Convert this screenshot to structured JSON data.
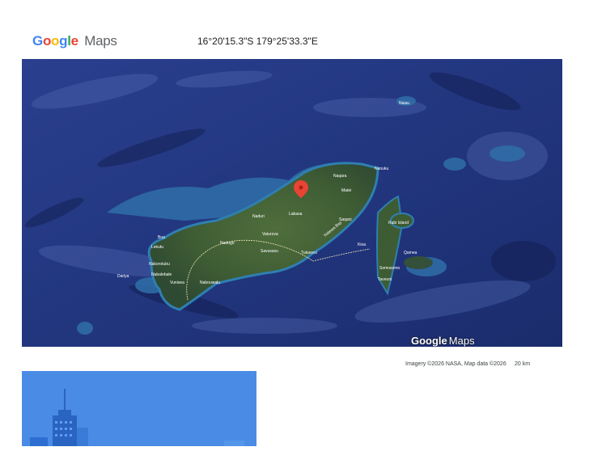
{
  "header": {
    "logo_google": "Google",
    "logo_maps": "Maps",
    "coordinates": "16°20'15.3\"S 179°25'33.3\"E"
  },
  "map": {
    "watermark_google": "Google",
    "watermark_maps": "Maps",
    "attribution": "Imagery ©2026 NASA, Map data ©2026",
    "scale": "20 km",
    "pin_color": "#ea4335",
    "labels": {
      "naiau": "Naiau",
      "nanuku": "Nanuku",
      "labasa": "Labasa",
      "naduri": "Naduri",
      "vaturova": "Vaturova",
      "savusavu": "Savusavu",
      "nabouwalu": "Nabouwalu",
      "nakorotubu": "Nakorotubu",
      "lekutu": "Lekutu",
      "daria": "Dariya",
      "saqani": "Saqani",
      "taveuni": "Taveuni",
      "somosomo": "Somosomo",
      "rabi": "Rabi Island",
      "kioa": "Kioa",
      "qamea": "Qamea",
      "matei": "Matei",
      "tukavesi": "Tukavesi",
      "natewa": "Natewa Bay",
      "naqara": "Naqara",
      "nabalebale": "Nabalebale",
      "vunisea": "Vunisea",
      "nadogo": "Nadogo",
      "bua": "Bua"
    }
  },
  "streetview": {
    "icon": "city-skyline-icon"
  }
}
